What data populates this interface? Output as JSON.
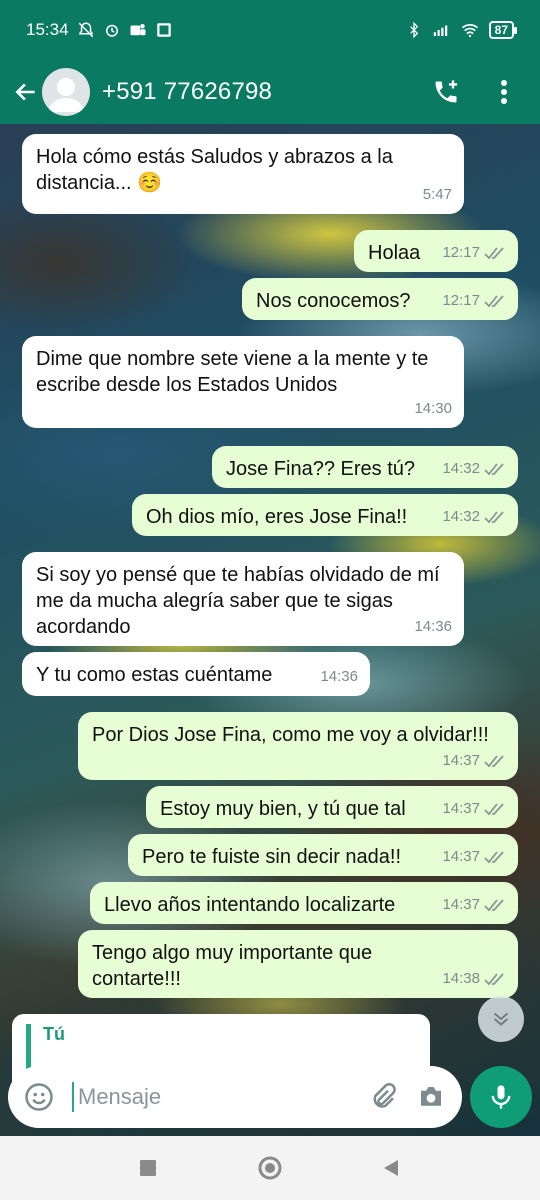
{
  "status_bar": {
    "time": "15:34",
    "battery": "87",
    "icons": [
      "silent-alarm-icon",
      "alarm-icon",
      "teams-icon",
      "gallery-icon",
      "bluetooth-icon",
      "signal-icon",
      "wifi-icon"
    ]
  },
  "header": {
    "contact": "+591 77626798",
    "actions": [
      "add-call-icon",
      "more-vert-icon"
    ]
  },
  "colors": {
    "header": "#0b7a63",
    "outgoing_bubble": "#e7fdd3",
    "incoming_bubble": "#ffffff",
    "accent": "#25a884"
  },
  "messages": [
    {
      "dir": "in",
      "text": "Hola cómo estás Saludos y abrazos a la distancia... ☺️",
      "time": "5:47"
    },
    {
      "dir": "out",
      "text": "Holaa",
      "time": "12:17"
    },
    {
      "dir": "out",
      "text": "Nos conocemos?",
      "time": "12:17"
    },
    {
      "dir": "in",
      "text": "Dime que nombre sete viene a la mente y te escribe desde los Estados Unidos",
      "time": "14:30"
    },
    {
      "dir": "out",
      "text": "Jose Fina?? Eres tú?",
      "time": "14:32"
    },
    {
      "dir": "out",
      "text": "Oh dios mío, eres Jose Fina!!",
      "time": "14:32"
    },
    {
      "dir": "in",
      "text": "Si soy yo pensé que te habías olvidado de mí me da mucha alegría saber que te sigas acordando",
      "time": "14:36"
    },
    {
      "dir": "in",
      "text": "Y tu como estas cuéntame",
      "time": "14:36"
    },
    {
      "dir": "out",
      "text": "Por Dios Jose Fina, como me voy a olvidar!!!",
      "time": "14:37"
    },
    {
      "dir": "out",
      "text": "Estoy muy bien, y tú que tal",
      "time": "14:37"
    },
    {
      "dir": "out",
      "text": "Pero te fuiste sin decir nada!!",
      "time": "14:37"
    },
    {
      "dir": "out",
      "text": "Llevo años intentando localizarte",
      "time": "14:37"
    },
    {
      "dir": "out",
      "text": "Tengo algo muy importante que contarte!!!",
      "time": "14:38"
    }
  ],
  "reply": {
    "author": "Tú"
  },
  "composer": {
    "placeholder": "Mensaje"
  }
}
